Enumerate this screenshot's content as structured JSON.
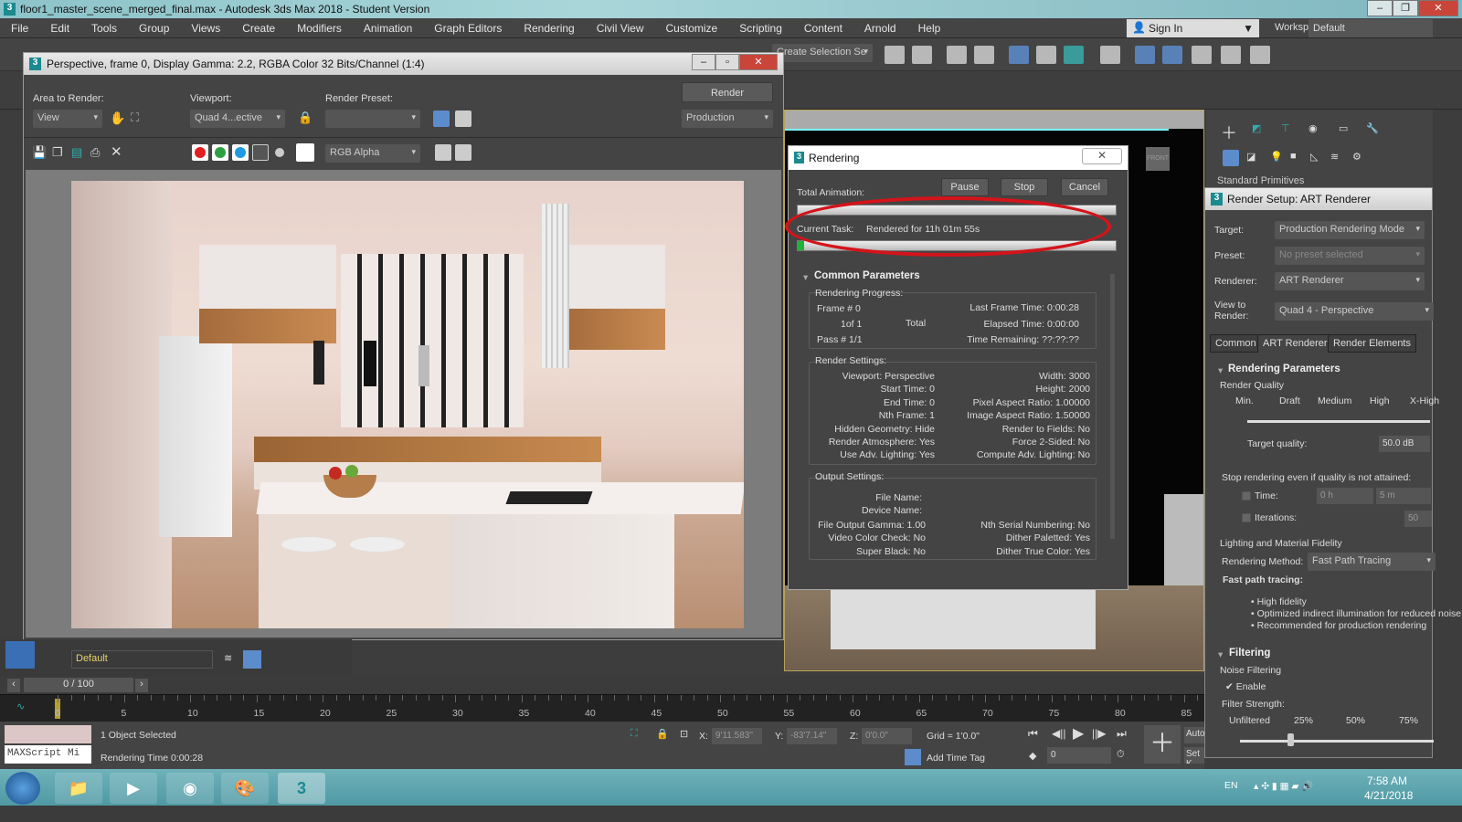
{
  "app": {
    "title": "floor1_master_scene_merged_final.max - Autodesk 3ds Max 2018 - Student Version",
    "logo": "3"
  },
  "menu": [
    "File",
    "Edit",
    "Tools",
    "Group",
    "Views",
    "Create",
    "Modifiers",
    "Animation",
    "Graph Editors",
    "Rendering",
    "Civil View",
    "Customize",
    "Scripting",
    "Content",
    "Arnold",
    "Help"
  ],
  "signin": "Sign In",
  "workspaces_label": "Workspaces:",
  "workspaces_value": "Default",
  "toolbar": {
    "selection_set": "Create Selection Se"
  },
  "command_panel": {
    "dropdown": "Standard Primitives"
  },
  "frame_window": {
    "title": "Perspective, frame 0, Display Gamma: 2.2, RGBA Color 32 Bits/Channel (1:4)",
    "area_label": "Area to Render:",
    "area_value": "View",
    "viewport_label": "Viewport:",
    "viewport_value": "Quad 4...ective",
    "preset_label": "Render Preset:",
    "preset_value": "",
    "render_button": "Render",
    "render_mode": "Production",
    "channel": "RGB Alpha",
    "colors": {
      "red": "#e02020",
      "green": "#2ea043",
      "blue": "#1e9be0"
    }
  },
  "rendering": {
    "title": "Rendering",
    "total_animation": "Total Animation:",
    "pause": "Pause",
    "stop": "Stop",
    "cancel": "Cancel",
    "current_task_label": "Current Task:",
    "current_task": "Rendered for 11h 01m 55s",
    "current_progress_pct": 2,
    "common_parameters": "Common Parameters",
    "progress_label": "Rendering Progress:",
    "frame": "Frame #  0",
    "of": "1of 1",
    "total": "Total",
    "pass": "Pass #  1/1",
    "last_frame_time": "Last Frame Time:  0:00:28",
    "elapsed": "Elapsed Time:  0:00:00",
    "remaining": "Time Remaining: ??:??:??",
    "render_settings_label": "Render Settings:",
    "render_settings_left": [
      "Viewport: Perspective",
      "Start Time: 0",
      "End Time: 0",
      "Nth Frame: 1",
      "Hidden Geometry: Hide",
      "Render Atmosphere: Yes",
      "Use Adv. Lighting: Yes"
    ],
    "render_settings_right": [
      "Width: 3000",
      "Height: 2000",
      "Pixel Aspect Ratio: 1.00000",
      "Image Aspect Ratio: 1.50000",
      "Render to Fields: No",
      "Force 2-Sided: No",
      "Compute Adv. Lighting: No"
    ],
    "output_settings_label": "Output Settings:",
    "file_name": "File Name:",
    "device_name": "Device Name:",
    "output_left": [
      "File Output Gamma: 1.00",
      "Video Color Check: No",
      "Super Black: No"
    ],
    "output_right": [
      "Nth Serial Numbering: No",
      "Dither Paletted: Yes",
      "Dither True Color: Yes"
    ]
  },
  "setup": {
    "title": "Render Setup: ART Renderer",
    "target_label": "Target:",
    "target": "Production Rendering Mode",
    "preset_label": "Preset:",
    "preset": "No preset selected",
    "renderer_label": "Renderer:",
    "renderer": "ART Renderer",
    "view_label": "View to Render:",
    "view": "Quad 4 - Perspective",
    "tabs": [
      "Common",
      "ART Renderer",
      "Render Elements"
    ],
    "rendering_parameters": "Rendering Parameters",
    "render_quality": "Render Quality",
    "quality_ticks": [
      "Min.",
      "Draft",
      "Medium",
      "High",
      "X-High"
    ],
    "target_quality_label": "Target quality:",
    "target_quality": "50.0 dB",
    "stop_label": "Stop rendering even if quality is not attained:",
    "time_label": "Time:",
    "time_h": "0 h",
    "time_m": "5 m",
    "iterations_label": "Iterations:",
    "iterations": "50",
    "fidelity": "Lighting and Material Fidelity",
    "method_label": "Rendering Method:",
    "method": "Fast Path Tracing",
    "fast_label": "Fast path tracing:",
    "bullets": [
      "High fidelity",
      "Optimized indirect illumination for reduced noise",
      "Recommended for production rendering"
    ],
    "filtering": "Filtering",
    "noise_filtering": "Noise Filtering",
    "enable": "Enable",
    "enable_checked": true,
    "strength_label": "Filter Strength:",
    "strength_ticks": [
      "Unfiltered",
      "25%",
      "50%",
      "75%"
    ],
    "strength_pct": 25
  },
  "bottom": {
    "layer": "Default",
    "frame_counter": "0 / 100",
    "ticks": [
      "0",
      "5",
      "10",
      "15",
      "20",
      "25",
      "30",
      "35",
      "40",
      "45",
      "50",
      "55",
      "60",
      "65",
      "70",
      "75",
      "80",
      "85"
    ],
    "maxscript": "MAXScript Mi",
    "selected": "1 Object Selected",
    "render_time": "Rendering Time  0:00:28",
    "x_label": "X:",
    "x": "9'11.583\"",
    "y_label": "Y:",
    "y": "-83'7.14\"",
    "z_label": "Z:",
    "z": "0'0.0\"",
    "grid": "Grid = 1'0.0\"",
    "add_time_tag": "Add Time Tag",
    "frame_field": "0",
    "auto": "Auto",
    "set_key": "Set K."
  },
  "taskbar": {
    "lang": "EN",
    "time": "7:58 AM",
    "date": "4/21/2018"
  }
}
